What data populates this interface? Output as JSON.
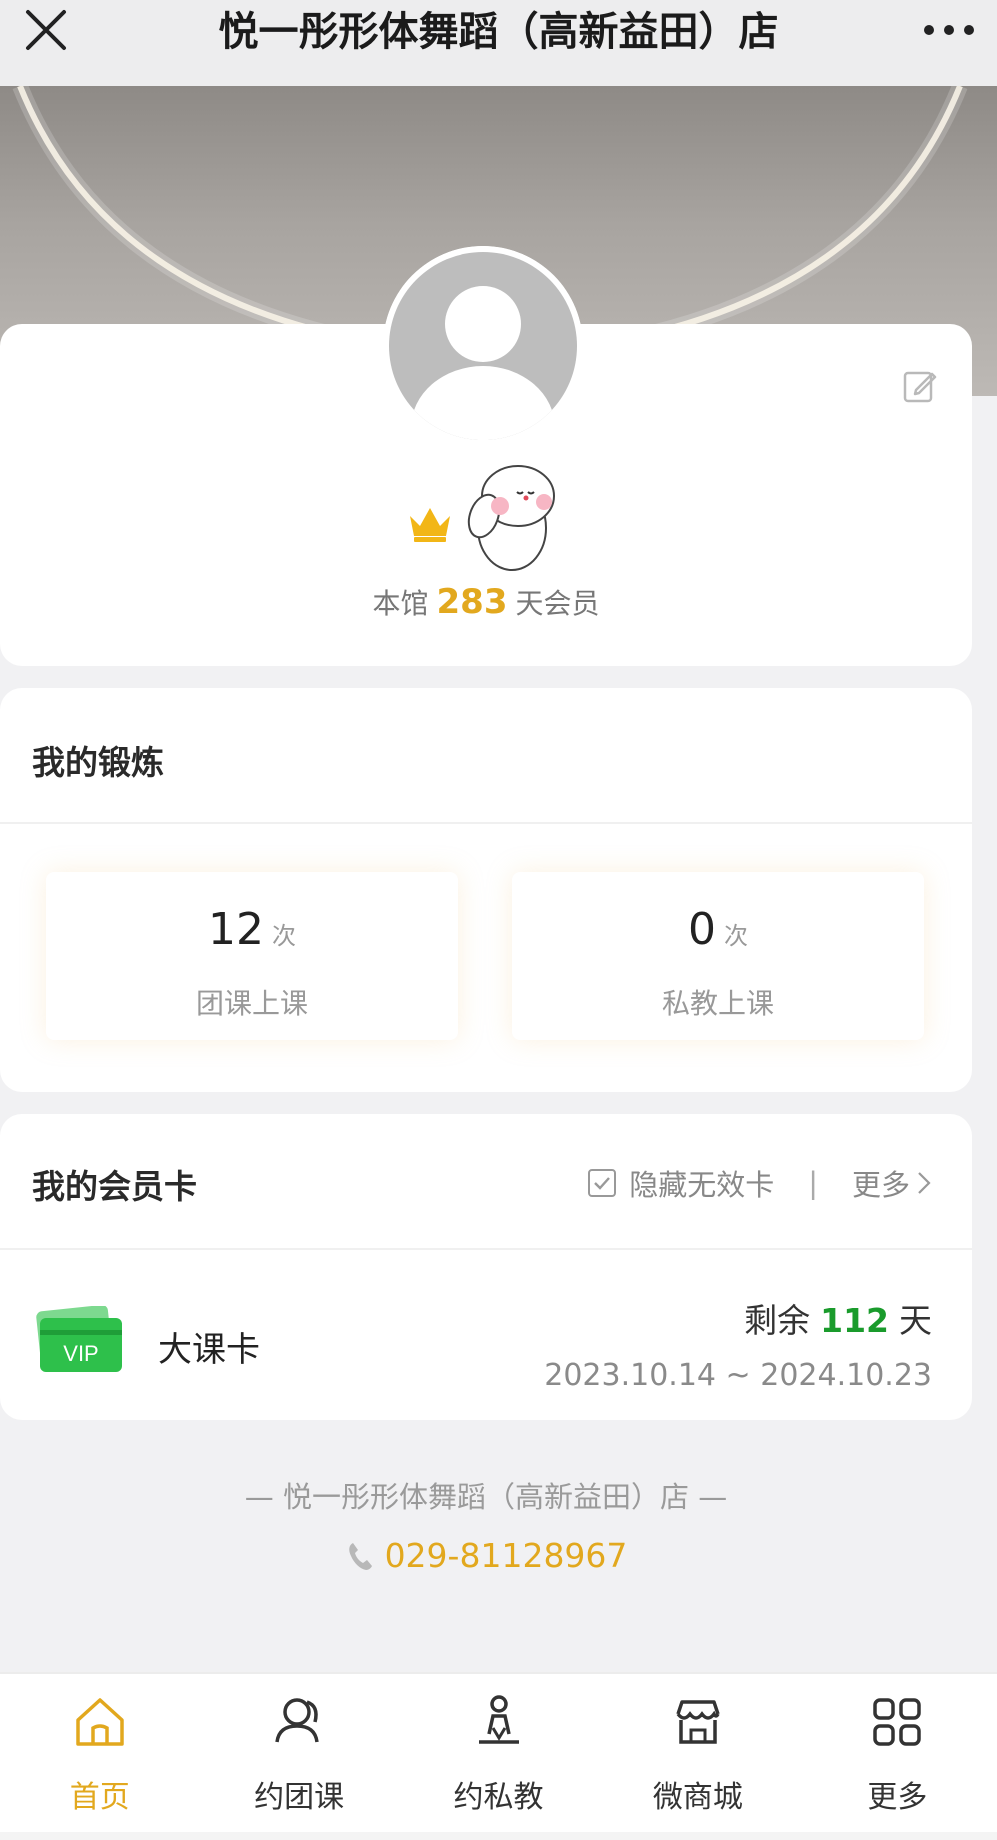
{
  "header": {
    "title": "悦一彤形体舞蹈（高新益田）店",
    "close_icon": "close-icon",
    "more_icon": "more-dots-icon"
  },
  "profile": {
    "member_prefix": "本馆",
    "member_days": "283",
    "member_suffix": "天会员",
    "icons": [
      "avatar-placeholder-icon",
      "edit-icon",
      "crown-icon",
      "bunny-sticker-icon"
    ]
  },
  "exercise": {
    "title": "我的锻炼",
    "stats": [
      {
        "value": "12",
        "unit": "次",
        "label": "团课上课"
      },
      {
        "value": "0",
        "unit": "次",
        "label": "私教上课"
      }
    ]
  },
  "membership": {
    "title": "我的会员卡",
    "hide_invalid_label": "隐藏无效卡",
    "separator": "|",
    "more_label": "更多",
    "card": {
      "icon": "VIP",
      "name": "大课卡",
      "remain_prefix": "剩余",
      "remain_days": "112",
      "remain_suffix": "天",
      "period": "2023.10.14 ~ 2024.10.23"
    }
  },
  "footer": {
    "store_line": "— 悦一彤形体舞蹈（高新益田）店 —",
    "phone": "029-81128967"
  },
  "tabs": [
    {
      "label": "首页",
      "icon": "home-icon",
      "active": true
    },
    {
      "label": "约团课",
      "icon": "group-class-icon",
      "active": false
    },
    {
      "label": "约私教",
      "icon": "private-coach-icon",
      "active": false
    },
    {
      "label": "微商城",
      "icon": "shop-icon",
      "active": false
    },
    {
      "label": "更多",
      "icon": "grid-icon",
      "active": false
    }
  ],
  "colors": {
    "accent": "#e2a81e",
    "remain_green": "#1a9b2c",
    "vip_green": "#2ec04b"
  }
}
